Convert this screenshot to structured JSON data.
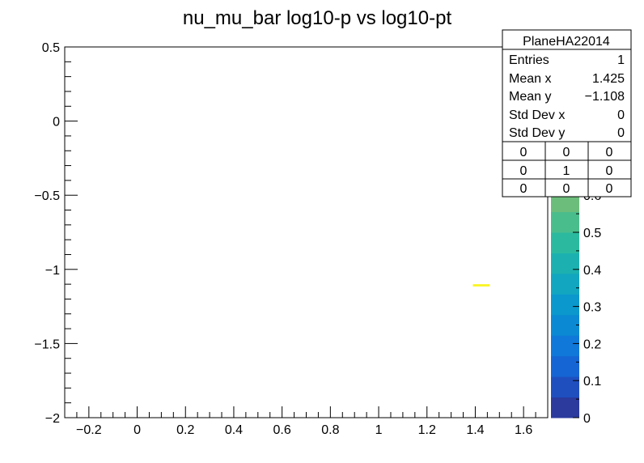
{
  "chart_data": {
    "type": "heatmap",
    "title": "nu_mu_bar  log10-p vs log10-pt",
    "xlabel": "",
    "ylabel": "",
    "xlim": [
      -0.3,
      1.7
    ],
    "ylim": [
      -2,
      0.5
    ],
    "x_ticks": [
      -0.2,
      0,
      0.2,
      0.4,
      0.6,
      0.8,
      1,
      1.2,
      1.4,
      1.6
    ],
    "x_tick_labels": [
      "−0.2",
      "0",
      "0.2",
      "0.4",
      "0.6",
      "0.8",
      "1",
      "1.2",
      "1.4",
      "1.6"
    ],
    "y_ticks": [
      0.5,
      0,
      -0.5,
      -1,
      -1.5,
      -2
    ],
    "y_tick_labels": [
      "0.5",
      "0",
      "−0.5",
      "−1",
      "−1.5",
      "−2"
    ],
    "cells": [
      {
        "x_from": 1.39,
        "x_to": 1.46,
        "y_from": -1.115,
        "y_to": -1.1,
        "value": 1
      }
    ],
    "colorbar": {
      "range": [
        0,
        1
      ],
      "tick_values": [
        0,
        0.1,
        0.2,
        0.3,
        0.4,
        0.5,
        0.6
      ],
      "tick_labels": [
        "0",
        "0.1",
        "0.2",
        "0.3",
        "0.4",
        "0.5",
        "0.6"
      ],
      "palette": [
        "#2b3a9c",
        "#1f4fbf",
        "#1565d4",
        "#0f78d8",
        "#0b89d2",
        "#0b98cc",
        "#12a6c0",
        "#1cb1b0",
        "#2bba9f",
        "#4abd8d",
        "#6cbd7b",
        "#8fba6a",
        "#b0b65b",
        "#cfb14d",
        "#e9b43f",
        "#f8c534",
        "#f9e22a",
        "#f9f420"
      ],
      "max_color": "#f9f420"
    }
  },
  "stats_box": {
    "title": "PlaneHA22014",
    "rows": [
      {
        "label": "Entries",
        "value": "1"
      },
      {
        "label": "Mean x",
        "value": "1.425"
      },
      {
        "label": "Mean y",
        "value": "−1.108"
      },
      {
        "label": "Std Dev x",
        "value": "0"
      },
      {
        "label": "Std Dev y",
        "value": "0"
      }
    ],
    "grid": [
      [
        "0",
        "0",
        "0"
      ],
      [
        "0",
        "1",
        "0"
      ],
      [
        "0",
        "0",
        "0"
      ]
    ]
  }
}
